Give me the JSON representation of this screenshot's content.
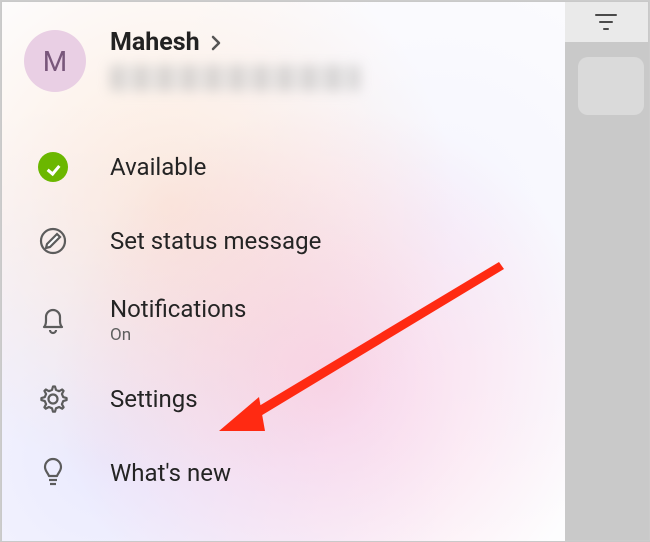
{
  "profile": {
    "avatar_initial": "M",
    "name": "Mahesh"
  },
  "menu": {
    "status": {
      "label": "Available"
    },
    "set_status": {
      "label": "Set status message"
    },
    "notifications": {
      "label": "Notifications",
      "sub": "On"
    },
    "settings": {
      "label": "Settings"
    },
    "whats_new": {
      "label": "What's new"
    }
  }
}
